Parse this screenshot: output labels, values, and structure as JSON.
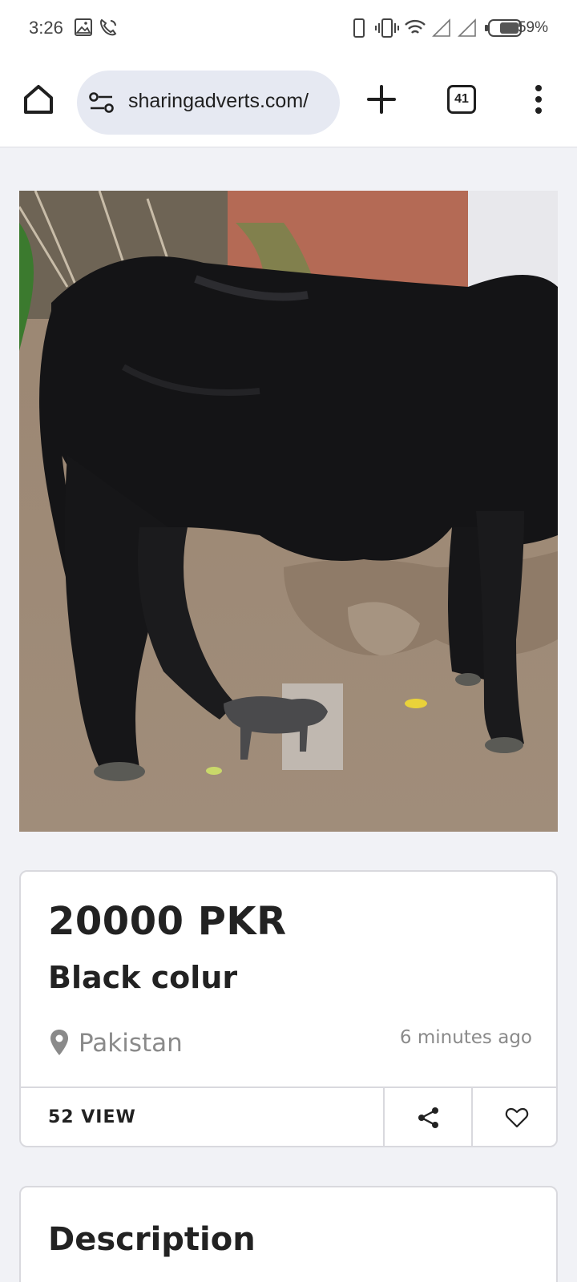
{
  "status_bar": {
    "time": "3:26",
    "battery": "59%",
    "icons": [
      "image-icon",
      "phone-call-icon",
      "device-icon",
      "vibrate-icon",
      "wifi-icon",
      "signal-icon",
      "signal-icon",
      "battery-icon"
    ]
  },
  "browser": {
    "url": "sharingadverts.com/",
    "tab_count": "41",
    "icons": [
      "home-icon",
      "site-settings-icon",
      "new-tab-plus-icon",
      "tab-switcher-icon",
      "more-vertical-icon"
    ]
  },
  "listing": {
    "photo_alt": "black-cow-photo",
    "price": "20000 PKR",
    "title": "Black colur",
    "location": "Pakistan",
    "posted": "6 minutes ago",
    "views": "52 VIEW"
  },
  "description": {
    "heading": "Description"
  },
  "colors": {
    "page_bg": "#f1f2f6",
    "url_pill": "#e6e9f2",
    "card_border": "#d9d9de",
    "muted_text": "#8a8a8a"
  }
}
